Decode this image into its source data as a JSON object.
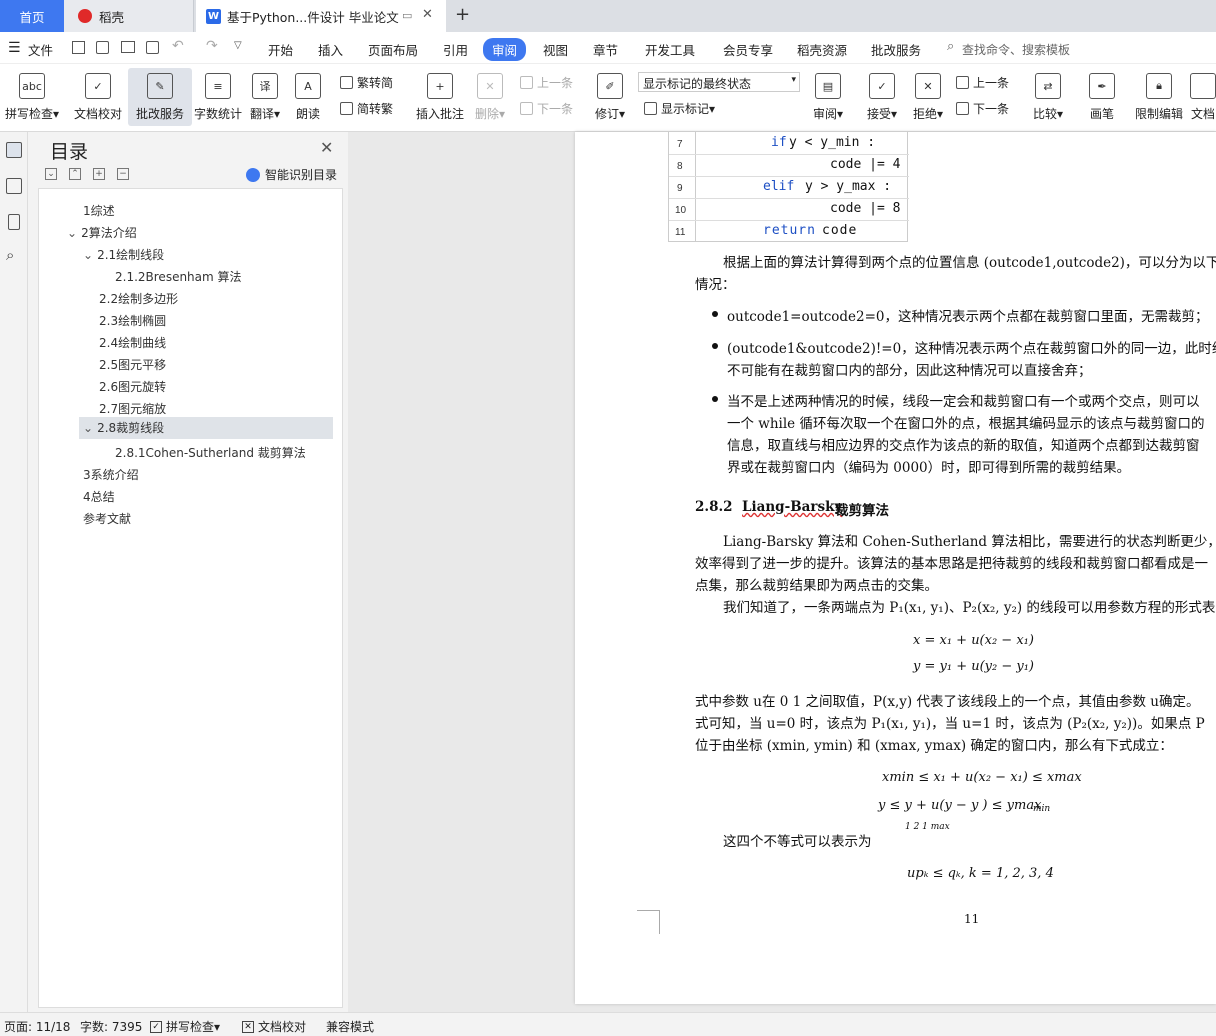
{
  "tabs": {
    "home": "首页",
    "daoke": "稻壳",
    "doc": "基于Python...件设计 毕业论文",
    "new": "+"
  },
  "menu": {
    "file": "文件",
    "items": [
      "开始",
      "插入",
      "页面布局",
      "引用",
      "审阅",
      "视图",
      "章节",
      "开发工具",
      "会员专享",
      "稻壳资源",
      "批改服务"
    ],
    "search": "查找命令、搜索模板"
  },
  "ribbon": {
    "spell": "拼写检查",
    "proof": "文档校对",
    "correct": "批改服务",
    "count": "字数统计",
    "translate": "翻译",
    "read": "朗读",
    "trad": "繁转简",
    "simp": "简转繁",
    "insert_comment": "插入批注",
    "delete": "删除",
    "prev_c": "上一条",
    "next_c": "下一条",
    "revise": "修订",
    "markup_select": "显示标记的最终状态",
    "show_markup": "显示标记",
    "review": "审阅",
    "accept": "接受",
    "reject": "拒绝",
    "prev": "上一条",
    "next": "下一条",
    "compare": "比较",
    "pen": "画笔",
    "restrict": "限制编辑",
    "docright": "文档"
  },
  "toc": {
    "title": "目录",
    "smart": "智能识别目录",
    "items": [
      "1综述",
      "2算法介绍",
      "2.1绘制线段",
      "2.1.2Bresenham 算法",
      "2.2绘制多边形",
      "2.3绘制椭圆",
      "2.4绘制曲线",
      "2.5图元平移",
      "2.6图元旋转",
      "2.7图元缩放",
      "2.8裁剪线段",
      "2.8.1Cohen-Sutherland 裁剪算法",
      "3系统介绍",
      "4总结",
      "参考文献"
    ]
  },
  "code": {
    "lines": [
      "7",
      "8",
      "9",
      "10",
      "11"
    ],
    "l7_kw": "if",
    "l7": "y  < y_min :",
    "l8": "code  |= 4",
    "l9_kw": "elif",
    "l9": "y > y_max :",
    "l10": "code  |= 8",
    "l11_kw": "return",
    "l11": "code"
  },
  "doc": {
    "p1a": "根据上面的算法计算得到两个点的位置信息 (outcode1,outcode2)，可以分为以下",
    "p1b": "情况：",
    "b1": "outcode1=outcode2=0，这种情况表示两个点都在裁剪窗口里面，无需裁剪；",
    "b2a": "(outcode1&outcode2)!=0，这种情况表示两个点在裁剪窗口外的同一边，此时线",
    "b2b": "不可能有在裁剪窗口内的部分，因此这种情况可以直接舍弃；",
    "b3a": "当不是上述两种情况的时候，线段一定会和裁剪窗口有一个或两个交点，则可以",
    "b3b": "一个  while 循环每次取一个在窗口外的点，根据其编码显示的该点与裁剪窗口的",
    "b3c": "信息，取直线与相应边界的交点作为该点的新的取值，知道两个点都到达裁剪窗",
    "b3d": "界或在裁剪窗口内（编码为  0000）时，即可得到所需的裁剪结果。",
    "h282_num": "2.8.2",
    "h282_title": "Liang-Barsky",
    "h282_rest": " 裁剪算法",
    "p2a": "Liang-Barsky 算法和  Cohen-Sutherland 算法相比，需要进行的状态判断更少，使",
    "p2b": "效率得到了进一步的提升。该算法的基本思路是把待裁剪的线段和裁剪窗口都看成是一",
    "p2c": "点集，那么裁剪结果即为两点击的交集。",
    "p3": "我们知道了，一条两端点为  P₁(x₁, y₁)、P₂(x₂, y₂) 的线段可以用参数方程的形式表",
    "eq1": "x =  x₁  +  u(x₂ − x₁)",
    "eq2": "y = y₁ + u(y₂ − y₁)",
    "p4a": "式中参数  u在 0 1 之间取值，P(x,y) 代表了该线段上的一个点，其值由参数  u确定。",
    "p4b": "式可知，当  u=0 时，该点为  P₁(x₁, y₁)，当  u=1 时，该点为  (P₂(x₂, y₂))。如果点  P",
    "p4c": "位于由坐标  (xmin, ymin) 和 (xmax, ymax) 确定的窗口内，那么有下式成立：",
    "ineq1": "xmin ≤ x₁ + u(x₂ − x₁) ≤ xmax",
    "ineq2": "y      ≤  y  +  u(y   − y  )  ≤ ymax",
    "ineq2sub": "1      2              1        max",
    "ineq2tail": "min",
    "p5": "这四个不等式可以表示为",
    "eq3": "upₖ ≤ qₖ, k = 1, 2, 3, 4",
    "page_no": "11"
  },
  "status": {
    "page": "页面: 11/18",
    "words": "字数: 7395",
    "spell": "拼写检查",
    "proof": "文档校对",
    "compat": "兼容模式"
  }
}
